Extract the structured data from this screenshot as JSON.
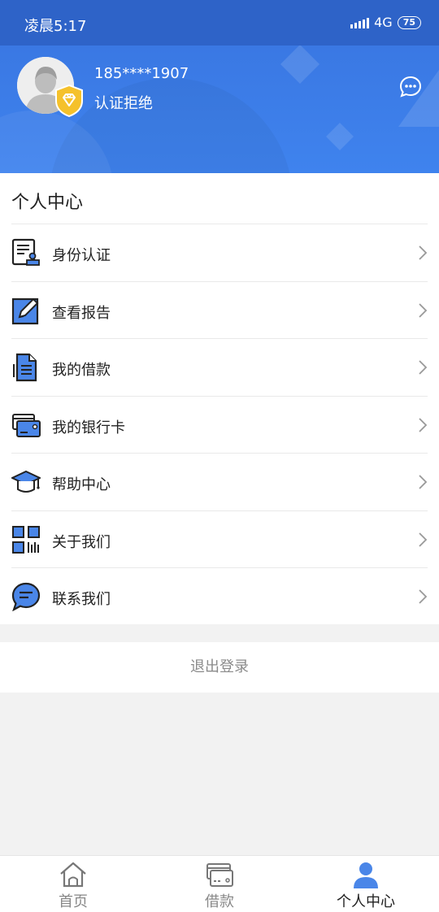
{
  "status_bar": {
    "time": "凌晨5:17",
    "network": "4G",
    "battery": "75"
  },
  "profile": {
    "phone": "185****1907",
    "auth_status": "认证拒绝"
  },
  "section_title": "个人中心",
  "menu": [
    {
      "label": "身份认证",
      "icon": "id-card-icon"
    },
    {
      "label": "查看报告",
      "icon": "pen-report-icon"
    },
    {
      "label": "我的借款",
      "icon": "document-icon"
    },
    {
      "label": "我的银行卡",
      "icon": "bank-card-icon"
    },
    {
      "label": "帮助中心",
      "icon": "graduation-cap-icon"
    },
    {
      "label": "关于我们",
      "icon": "qr-code-icon"
    },
    {
      "label": "联系我们",
      "icon": "chat-bubble-icon"
    }
  ],
  "logout_label": "退出登录",
  "bottom_nav": [
    {
      "label": "首页",
      "icon": "home-icon",
      "active": false
    },
    {
      "label": "借款",
      "icon": "card-icon",
      "active": false
    },
    {
      "label": "个人中心",
      "icon": "user-icon",
      "active": true
    }
  ],
  "colors": {
    "brand_blue": "#3f83ee",
    "icon_blue": "#4a86e8",
    "shield_gold": "#f5c12b"
  }
}
